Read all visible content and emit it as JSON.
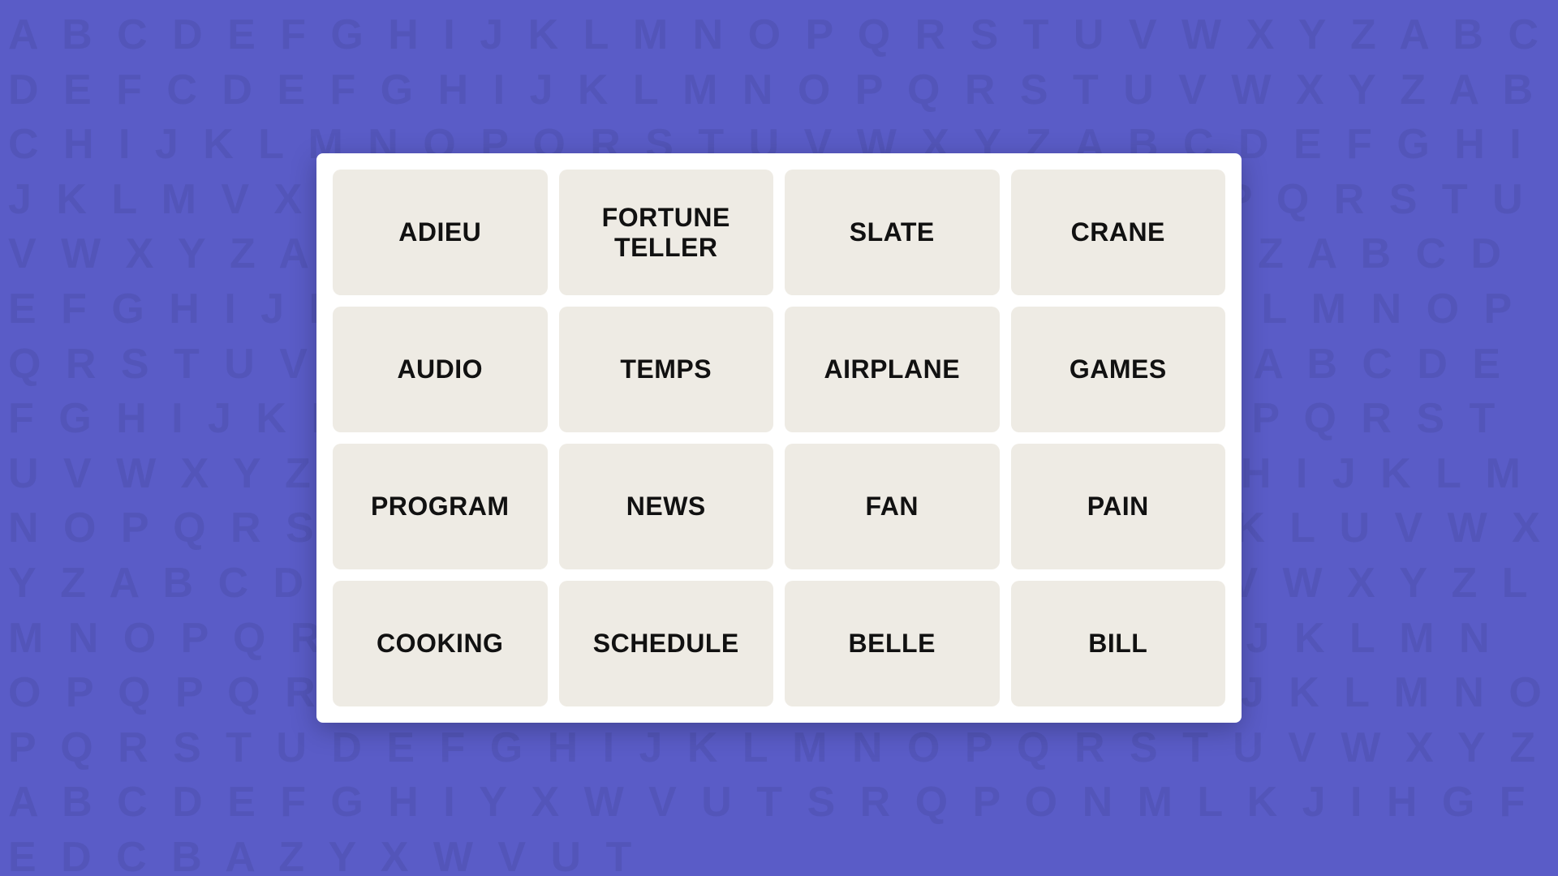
{
  "background": {
    "alphabet_text": "A B C D E F G H I J K L M N O P Q R S T U V W X Y Z A B C D E F G H I J K L M N O P Q R S T U V W X Y Z A B C D E F G H I J K L M N O P Q R S T U V W X Y Z A B C D E F G H I J K L M N O P Q R S T U V W X Y Z A B C D E F G H I J K L M N O P Q R S T U V W X Y Z A B C D E F G H I J K L M N O P Q R S T U V W X Y Z A B C D E F G H I J K L M N O P Q R S T U V W X Y Z A B C D E F G H I J K L M N O P Q R S T U V W X Y Z A B C D E F G H I J K L M N O P Q R S T U V W X Y Z A B C D E F G H I J K L M N O P Q R S T U V W X Y Z A B C D E F G H I J K L M N O P Q R S T U V W X Y Z A B C D E F G H I J K L M N O P Q R S T U V W X Y Z A B C D E F G H I J K L M N O P Q R S T U V W X Y Z A B C D E F G H I J K L M N O P Q R S T U V W X Y Z A B C D E F G H I J K L M N O P Q R S T U V W X Y Z A B C D E F G H I J K L M N O P Q R S T U V W X Y Z A B C D E F G H I J K L M N O P Q R S T U V W X Y Z A B C D E F G H I J K L M N O P Q R S T U V W X Y Z A B C D E F G H I J K L M N O P Q R S T U V W X Y Z A B C D E F G H I J K L M N O P Q R S T U V W X Y Z"
  },
  "grid": {
    "tiles": [
      {
        "id": 1,
        "label": "ADIEU"
      },
      {
        "id": 2,
        "label": "FORTUNE\nTELLER"
      },
      {
        "id": 3,
        "label": "SLATE"
      },
      {
        "id": 4,
        "label": "CRANE"
      },
      {
        "id": 5,
        "label": "AUDIO"
      },
      {
        "id": 6,
        "label": "TEMPS"
      },
      {
        "id": 7,
        "label": "AIRPLANE"
      },
      {
        "id": 8,
        "label": "GAMES"
      },
      {
        "id": 9,
        "label": "PROGRAM"
      },
      {
        "id": 10,
        "label": "NEWS"
      },
      {
        "id": 11,
        "label": "FAN"
      },
      {
        "id": 12,
        "label": "PAIN"
      },
      {
        "id": 13,
        "label": "COOKING"
      },
      {
        "id": 14,
        "label": "SCHEDULE"
      },
      {
        "id": 15,
        "label": "BELLE"
      },
      {
        "id": 16,
        "label": "BILL"
      }
    ]
  }
}
